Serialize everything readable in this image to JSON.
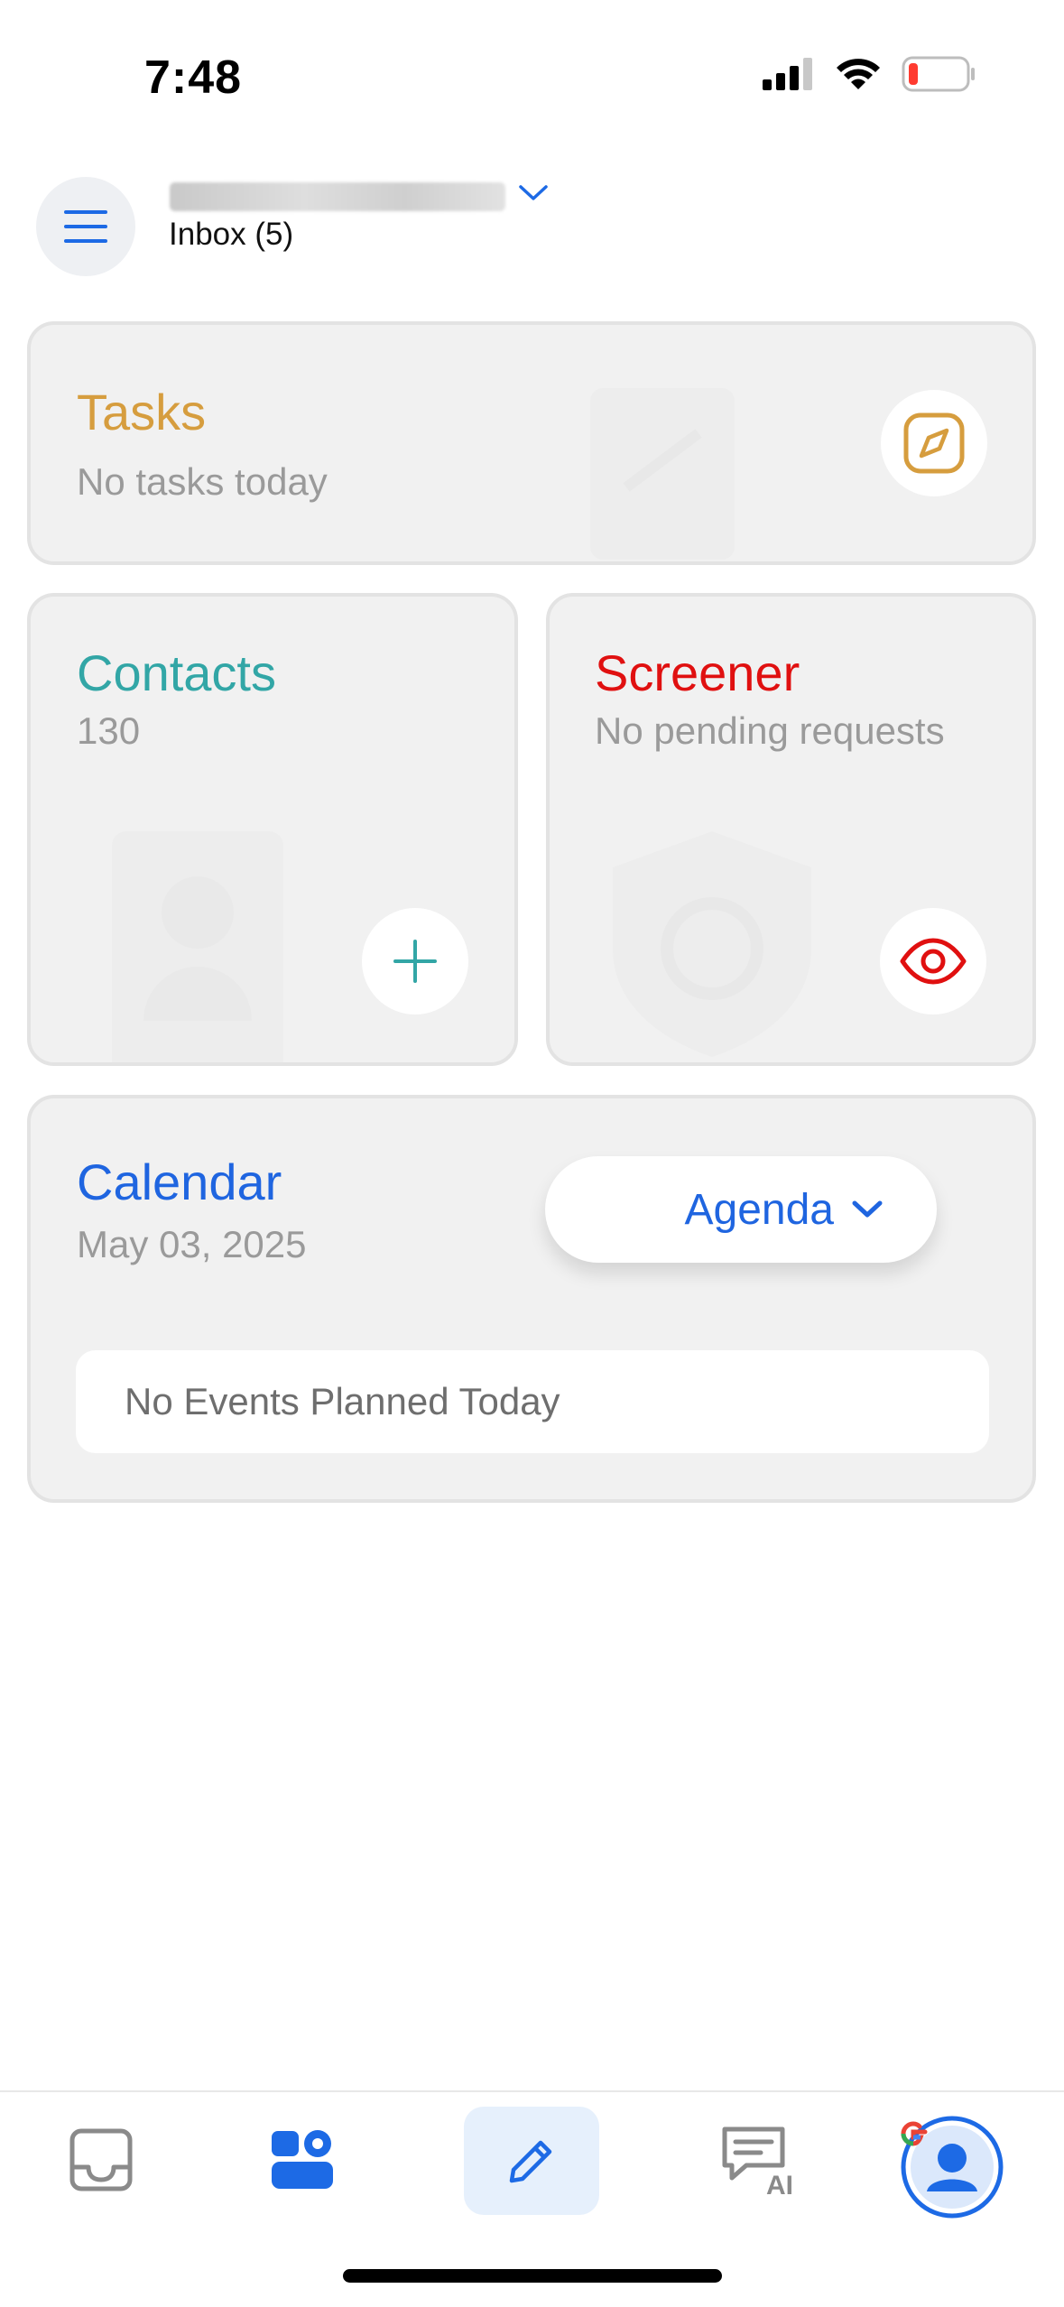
{
  "status_bar": {
    "time": "7:48"
  },
  "header": {
    "inbox_label": "Inbox (5)"
  },
  "tasks": {
    "title": "Tasks",
    "subtitle": "No tasks today"
  },
  "contacts": {
    "title": "Contacts",
    "count": "130"
  },
  "screener": {
    "title": "Screener",
    "subtitle": "No pending requests"
  },
  "calendar": {
    "title": "Calendar",
    "date": "May 03, 2025",
    "view_selector": "Agenda",
    "empty_message": "No Events Planned Today"
  },
  "tab_bar": {
    "ai_label": "AI"
  },
  "icons": {
    "menu": "hamburger-menu-icon",
    "account_dropdown": "chevron-down-icon",
    "tasks": "compass-icon",
    "contacts_add": "plus-icon",
    "screener": "eye-icon",
    "tab_inbox": "inbox-tray-icon",
    "tab_dashboard": "dashboard-widgets-icon",
    "tab_compose": "pencil-icon",
    "tab_ai": "ai-chat-icon",
    "tab_profile": "avatar-icon"
  },
  "colors": {
    "tasks": "#d69d3e",
    "contacts": "#32a6a6",
    "screener": "#e01010",
    "calendar": "#1f65e0",
    "accent_blue": "#1d6ae5"
  }
}
